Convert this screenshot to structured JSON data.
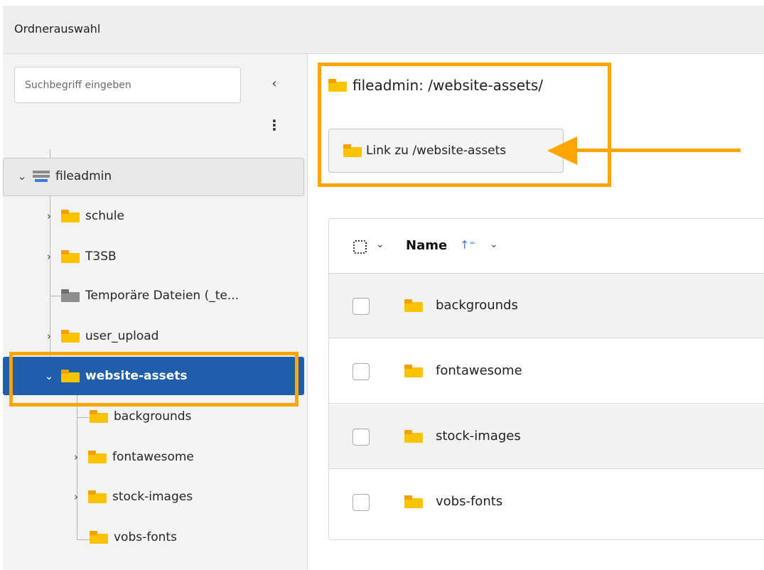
{
  "window": {
    "title": "Ordnerauswahl"
  },
  "sidebar": {
    "search_placeholder": "Suchbegriff eingeben",
    "collapse_glyph": "‹",
    "more_glyph": "⋮",
    "tree": {
      "root_label": "fileadmin",
      "items": [
        {
          "label": "schule",
          "icon": "folder-icon"
        },
        {
          "label": "T3SB",
          "icon": "folder-icon"
        },
        {
          "label": "Temporäre Dateien (_te...",
          "icon": "folder-gray-icon"
        },
        {
          "label": "user_upload",
          "icon": "folder-icon"
        },
        {
          "label": "website-assets",
          "icon": "folder-icon",
          "selected": true
        }
      ],
      "children": [
        {
          "label": "backgrounds"
        },
        {
          "label": "fontawesome"
        },
        {
          "label": "stock-images"
        },
        {
          "label": "vobs-fonts"
        }
      ]
    }
  },
  "main": {
    "path_title": "fileadmin: /website-assets/",
    "link_button_label": "Link zu /website-assets",
    "table": {
      "col_name": "Name",
      "sort_glyph": "↑⁼",
      "rows": [
        {
          "name": "backgrounds"
        },
        {
          "name": "fontawesome"
        },
        {
          "name": "stock-images"
        },
        {
          "name": "vobs-fonts"
        }
      ]
    }
  },
  "colors": {
    "highlight": "#ffa500",
    "selected_bg": "#1f5ea8",
    "folder": "#fcc400"
  }
}
